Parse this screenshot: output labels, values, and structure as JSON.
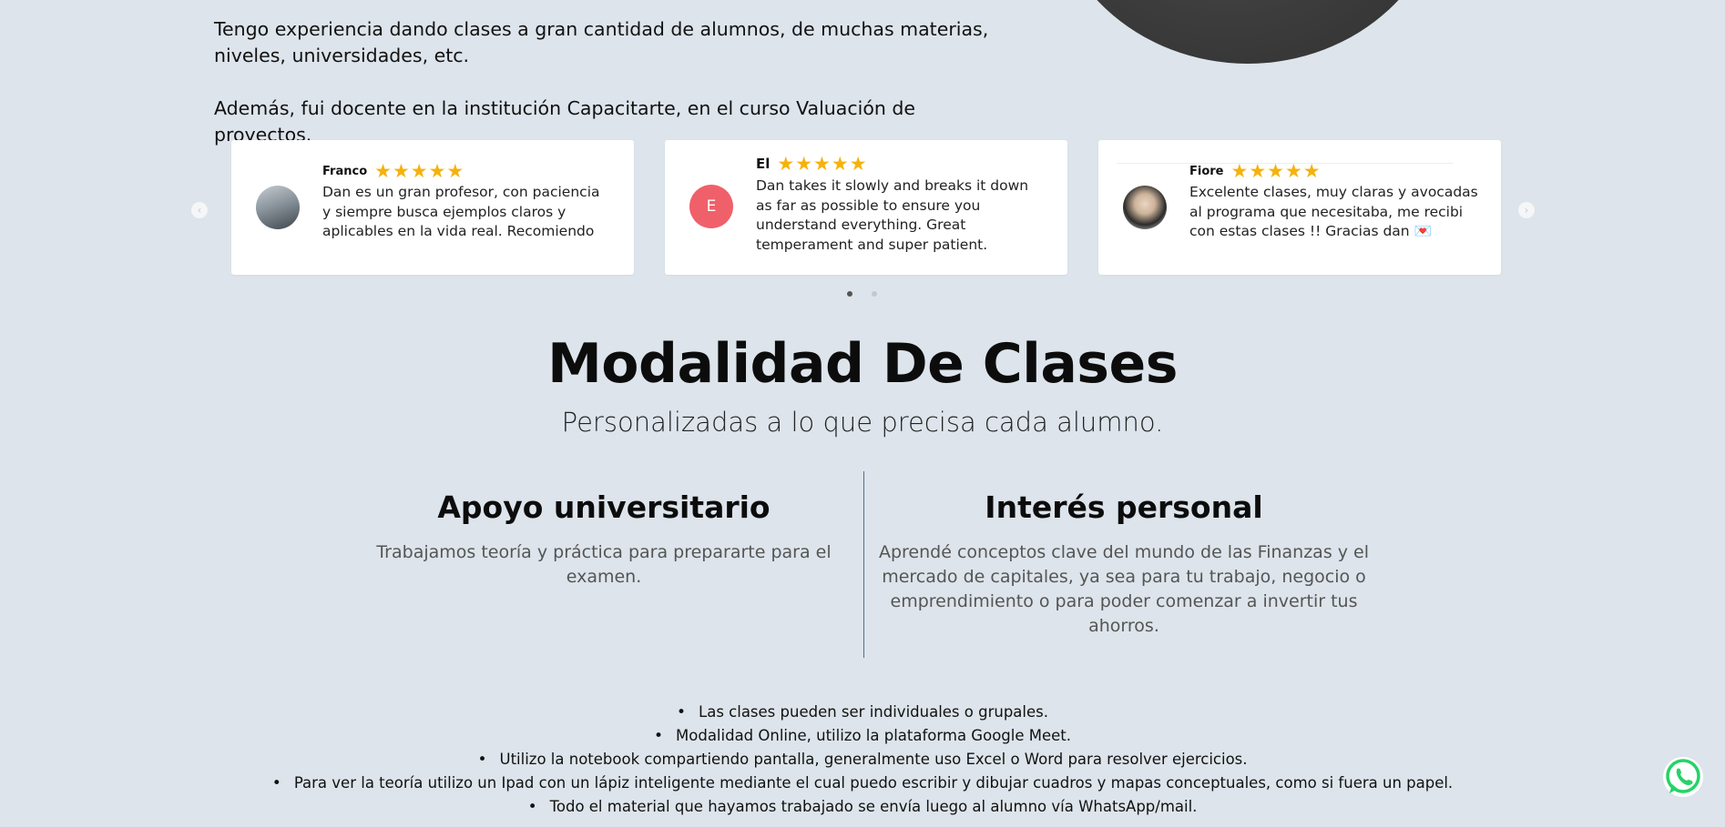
{
  "intro": {
    "paragraph1": "Tengo experiencia dando clases a gran cantidad de alumnos, de muchas materias, niveles, universidades, etc.",
    "paragraph2": "Además, fui docente en la institución Capacitarte, en el curso Valuación de proyectos."
  },
  "reviews": [
    {
      "name": "Franco",
      "stars": "★★★★★",
      "rating": 5,
      "text": "Dan es un gran profesor, con paciencia y siempre busca ejemplos claros y aplicables en la vida real. Recomiendo"
    },
    {
      "name": "El",
      "initial": "E",
      "stars": "★★★★★",
      "rating": 5,
      "text": "Dan takes it slowly and breaks it down as far as possible to ensure you understand everything. Great temperament and super patient."
    },
    {
      "name": "Fiore",
      "stars": "★★★★★",
      "rating": 5,
      "text": "Excelente clases, muy claras y avocadas al programa que necesitaba, me recibi con estas  clases !! Gracias  dan 💌"
    }
  ],
  "carousel": {
    "prev_icon": "‹",
    "next_icon": "›",
    "total_pages": 2,
    "current_page": 1
  },
  "modalidad": {
    "title": "Modalidad De Clases",
    "subtitle": "Personalizadas a lo que precisa cada alumno.",
    "left": {
      "heading": "Apoyo universitario",
      "text": "Trabajamos teoría y práctica para prepararte para el examen."
    },
    "right": {
      "heading": "Interés personal",
      "text": "Aprendé conceptos clave del mundo de las Finanzas y el mercado de capitales, ya sea para tu trabajo, negocio o emprendimiento o para poder comenzar a invertir tus ahorros."
    }
  },
  "bullets": [
    "Las clases pueden ser individuales o grupales.",
    "Modalidad Online, utilizo la plataforma Google Meet.",
    "Utilizo la notebook compartiendo pantalla, generalmente uso Excel o Word para resolver ejercicios.",
    "Para ver la teoría utilizo un Ipad con un lápiz inteligente mediante el cual puedo escribir y dibujar cuadros y mapas conceptuales, como si fuera un papel.",
    "Todo el material que hayamos trabajado se envía luego al alumno vía WhatsApp/mail."
  ],
  "colors": {
    "background": "#dde4eb",
    "star": "#f6b20b",
    "avatar_letter_bg": "#f0606a",
    "whatsapp": "#25d366"
  }
}
